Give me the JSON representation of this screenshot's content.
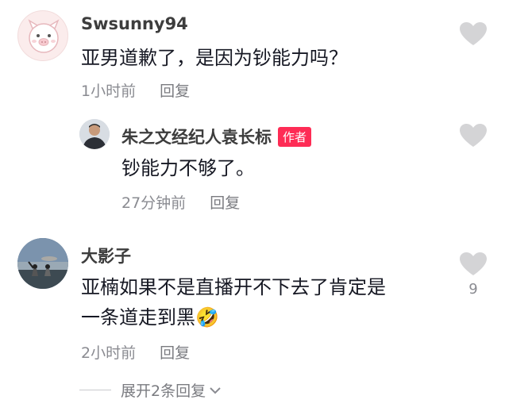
{
  "comments": [
    {
      "username": "Swsunny94",
      "content": "亚男道歉了，是因为钞能力吗？",
      "time": "1小时前",
      "reply_label": "回复",
      "avatar_icon": "pig-icon",
      "replies": [
        {
          "username": "朱之文经纪人袁长标",
          "badge": "作者",
          "content": "钞能力不够了。",
          "time": "27分钟前",
          "reply_label": "回复",
          "avatar_icon": "person-photo"
        }
      ]
    },
    {
      "username": "大影子",
      "content_line1": "亚楠如果不是直播开不下去了肯定是",
      "content_line2": "一条道走到黑",
      "emoji": "🤣",
      "time": "2小时前",
      "reply_label": "回复",
      "like_count": "9",
      "avatar_icon": "beach-photo"
    }
  ],
  "expand_label": "展开2条回复",
  "colors": {
    "badge": "#fe2c55",
    "heart": "#d4d4d6",
    "meta": "#8a8b91"
  }
}
